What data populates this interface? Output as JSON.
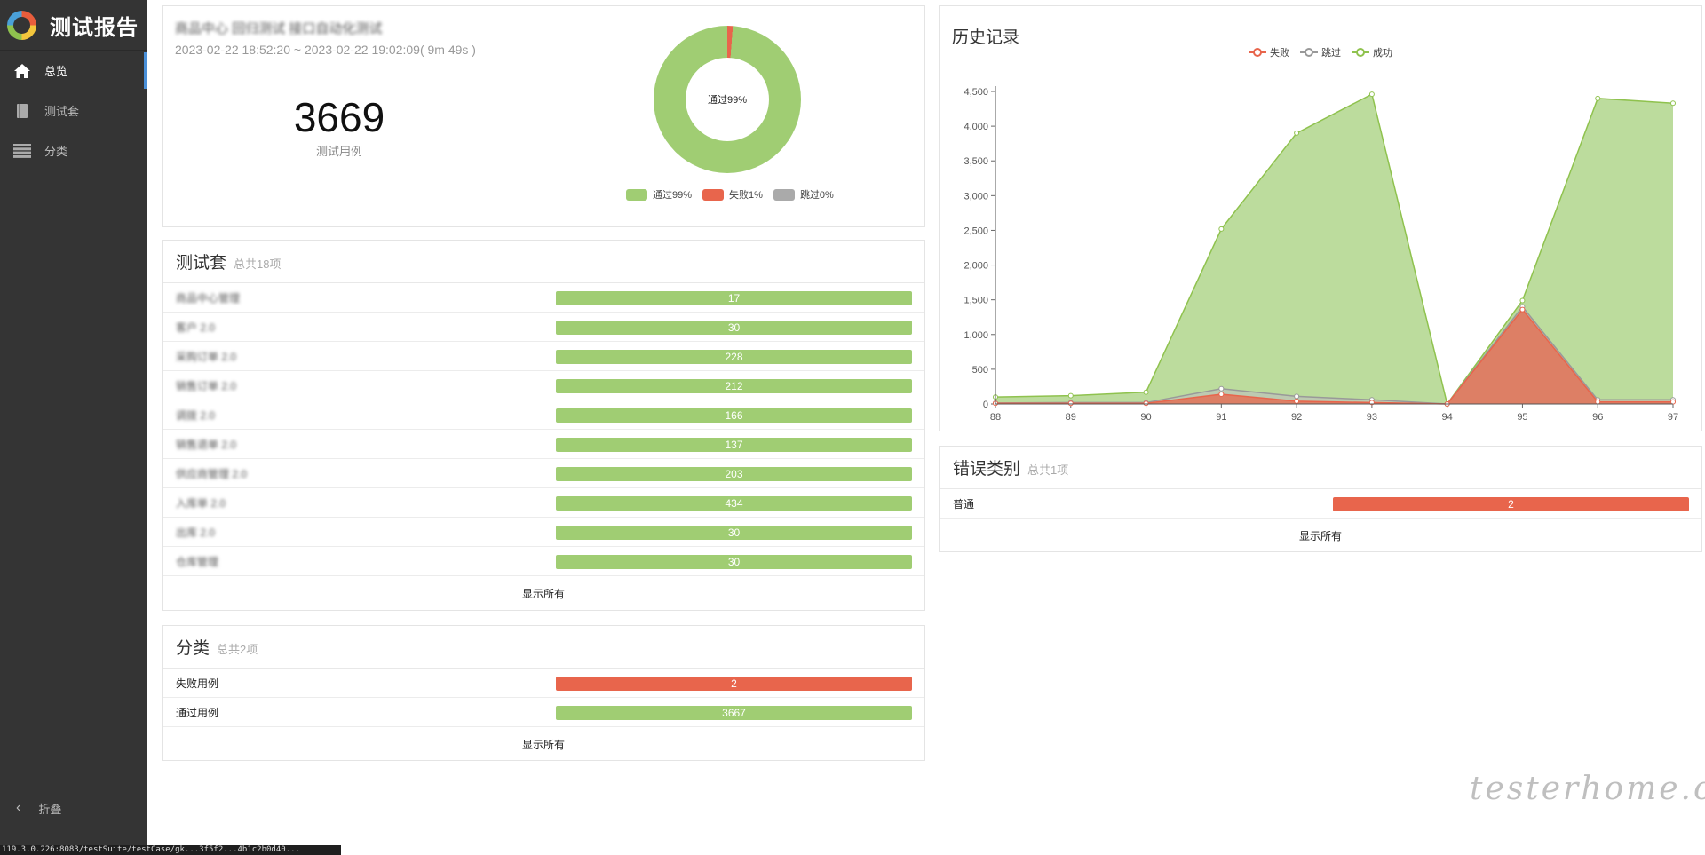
{
  "app": {
    "title": "测试报告"
  },
  "sidebar": {
    "items": [
      {
        "label": "总览",
        "icon": "home-icon",
        "active": true
      },
      {
        "label": "测试套",
        "icon": "book-icon",
        "active": false
      },
      {
        "label": "分类",
        "icon": "list-icon",
        "active": false
      }
    ],
    "collapse_label": "折叠"
  },
  "status_url": "119.3.0.226:8083/testSuite/testCase/gk...3f5f2...4b1c2b0d40...",
  "summary": {
    "report_name": "商品中心 回归测试 接口自动化测试",
    "time_range": "2023-02-22 18:52:20 ~ 2023-02-22 19:02:09( 9m 49s )",
    "total": "3669",
    "total_label": "测试用例",
    "donut_center": "通过99%",
    "legend": [
      {
        "label": "通过99%",
        "color": "#a0cd73"
      },
      {
        "label": "失败1%",
        "color": "#e8654c"
      },
      {
        "label": "跳过0%",
        "color": "#aaaaaa"
      }
    ]
  },
  "suites": {
    "title": "测试套",
    "count": "总共18项",
    "rows": [
      {
        "name": "商品中心管理",
        "value": "17"
      },
      {
        "name": "客户 2.0",
        "value": "30"
      },
      {
        "name": "采购订单 2.0",
        "value": "228"
      },
      {
        "name": "销售订单 2.0",
        "value": "212"
      },
      {
        "name": "调拨 2.0",
        "value": "166"
      },
      {
        "name": "销售退单 2.0",
        "value": "137"
      },
      {
        "name": "供应商管理 2.0",
        "value": "203"
      },
      {
        "name": "入库单 2.0",
        "value": "434"
      },
      {
        "name": "出库 2.0",
        "value": "30"
      },
      {
        "name": "仓库管理",
        "value": "30"
      }
    ],
    "show_all": "显示所有"
  },
  "categories": {
    "title": "分类",
    "count": "总共2项",
    "rows": [
      {
        "name": "失败用例",
        "value": "2",
        "status": "failed"
      },
      {
        "name": "通过用例",
        "value": "3667",
        "status": "passed"
      }
    ],
    "show_all": "显示所有"
  },
  "errors": {
    "title": "错误类别",
    "count": "总共1项",
    "rows": [
      {
        "name": "普通",
        "value": "2",
        "status": "failed"
      }
    ],
    "show_all": "显示所有"
  },
  "history": {
    "title": "历史记录",
    "legend": [
      {
        "label": "失败",
        "color": "#e8654c"
      },
      {
        "label": "跳过",
        "color": "#999999"
      },
      {
        "label": "成功",
        "color": "#8fc24e"
      }
    ]
  },
  "chart_data": {
    "type": "area",
    "title": "历史记录",
    "x": [
      88,
      89,
      90,
      91,
      92,
      93,
      94,
      95,
      96,
      97
    ],
    "ylim": [
      0,
      4500
    ],
    "yticks": [
      0,
      500,
      1000,
      1500,
      2000,
      2500,
      3000,
      3500,
      4000,
      4500
    ],
    "ytick_labels": [
      "0",
      "500",
      "1,000",
      "1,500",
      "2,000",
      "2,500",
      "3,000",
      "3,500",
      "4,000",
      "4,500"
    ],
    "legend_position": "top-center",
    "series": [
      {
        "name": "失败",
        "color": "#e8654c",
        "values": [
          10,
          10,
          10,
          140,
          40,
          20,
          0,
          1360,
          30,
          30
        ]
      },
      {
        "name": "跳过",
        "color": "#999999",
        "values": [
          15,
          20,
          20,
          220,
          110,
          60,
          0,
          1400,
          60,
          60
        ]
      },
      {
        "name": "成功",
        "color": "#8fc24e",
        "values": [
          100,
          120,
          170,
          2520,
          3900,
          4460,
          0,
          1490,
          4400,
          4330
        ]
      }
    ]
  },
  "watermark": "testerhome.com"
}
